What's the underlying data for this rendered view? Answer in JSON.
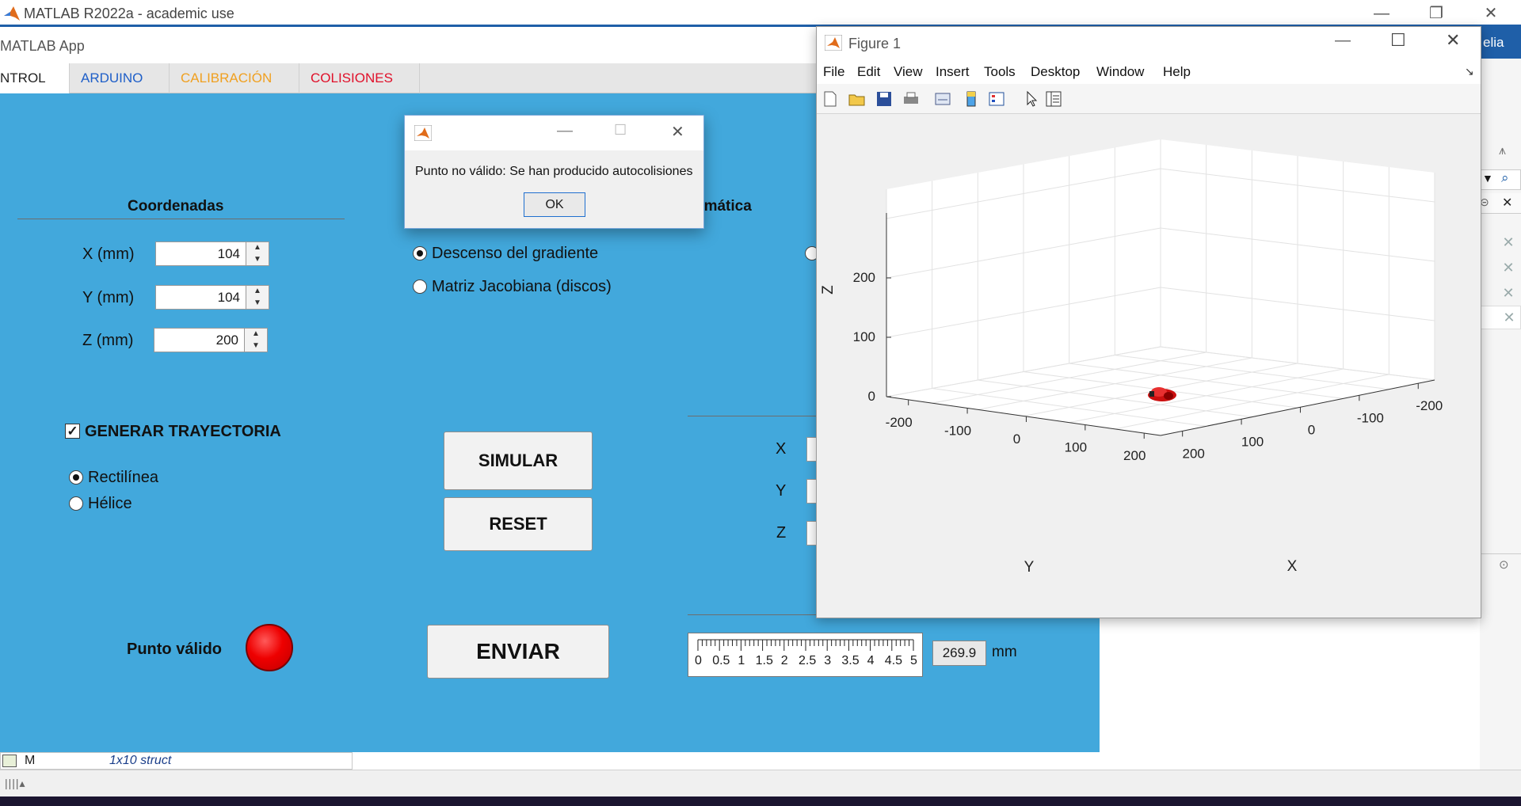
{
  "main_window": {
    "title": "MATLAB R2022a - academic use",
    "right_blue_fragment": "elia"
  },
  "app": {
    "title": "MATLAB App",
    "tabs": [
      {
        "label": "NTROL",
        "color": "#222222"
      },
      {
        "label": "ARDUINO",
        "color": "#1f5fc8"
      },
      {
        "label": "CALIBRACIÓN",
        "color": "#f0a020"
      },
      {
        "label": "COLISIONES",
        "color": "#e0102a"
      }
    ],
    "coordenadas": {
      "header": "Coordenadas",
      "x_label": "X (mm)",
      "x_value": "104",
      "y_label": "Y (mm)",
      "y_value": "104",
      "z_label": "Z (mm)",
      "z_value": "200"
    },
    "cinematica": {
      "header_fragment": "emática",
      "options": [
        {
          "label": "Descenso del gradiente",
          "selected": true
        },
        {
          "label": "Matriz Jacobiana (discos)",
          "selected": false
        }
      ]
    },
    "trajectory": {
      "checkbox_label": "GENERAR TRAYECTORIA",
      "checked": true,
      "options": [
        {
          "label": "Rectilínea",
          "selected": true
        },
        {
          "label": "Hélice",
          "selected": false
        }
      ]
    },
    "buttons": {
      "simular": "SIMULAR",
      "reset": "RESET",
      "enviar": "ENVIAR"
    },
    "output_labels": {
      "x": "X",
      "y": "Y",
      "z": "Z"
    },
    "punto_valido_label": "Punto válido",
    "punto_valido_color": "#ee0000",
    "slider": {
      "ticks": [
        "0",
        "0.5",
        "1",
        "1.5",
        "2",
        "2.5",
        "3",
        "3.5",
        "4",
        "4.5",
        "5"
      ],
      "value_display": "269.9",
      "unit": "mm"
    }
  },
  "dialog": {
    "message": "Punto no válido: Se han producido autocolisiones",
    "ok_label": "OK"
  },
  "workspace": {
    "var_name": "M",
    "var_value": "1x10 struct"
  },
  "figure": {
    "title": "Figure 1",
    "menu": [
      "File",
      "Edit",
      "View",
      "Insert",
      "Tools",
      "Desktop",
      "Window",
      "Help"
    ],
    "toolbar_icons": [
      "new-figure-icon",
      "open-icon",
      "save-icon",
      "print-icon",
      "link-plot-icon",
      "colorbar-icon",
      "legend-icon",
      "pointer-icon",
      "property-inspector-icon"
    ]
  },
  "chart_data": {
    "type": "scatter",
    "projection": "3d",
    "xlabel": "X",
    "ylabel": "Y",
    "zlabel": "Z",
    "x_ticks": [
      "-200",
      "-100",
      "0",
      "100",
      "200"
    ],
    "y_ticks": [
      "-200",
      "-100",
      "0",
      "100",
      "200"
    ],
    "z_ticks": [
      "0",
      "100",
      "200"
    ],
    "grid": true,
    "marker_color": "#cc1010"
  }
}
